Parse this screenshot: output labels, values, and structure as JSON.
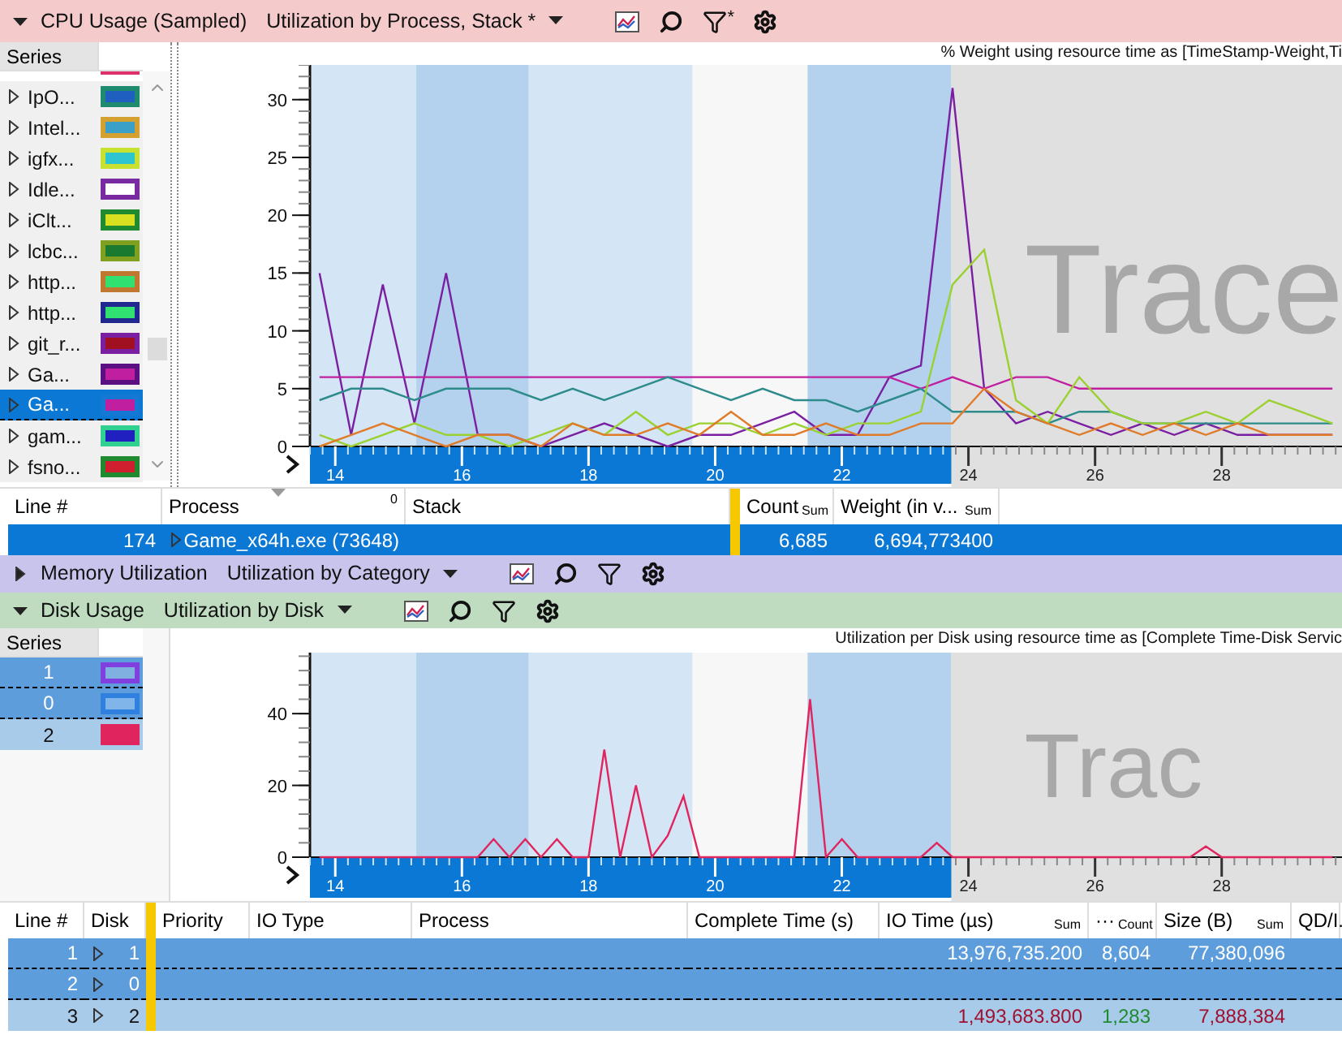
{
  "cpu_panel": {
    "header": {
      "expanded": true,
      "color": "#f4caca",
      "title": "CPU Usage (Sampled)",
      "preset": "Utilization by Process, Stack *",
      "filter_mark": "*"
    },
    "series_list": {
      "heading": "Series",
      "cut_off_swatch": {
        "color": "#e0306a"
      },
      "items": [
        {
          "name": "IpO...",
          "expanded": false,
          "swatch": {
            "fill": {
              "color": "#1f5fbf"
            },
            "border": {
              "color": "#1e8a6e"
            }
          },
          "selected": false
        },
        {
          "name": "Intel...",
          "expanded": false,
          "swatch": {
            "fill": {
              "color": "#3aa0c8"
            },
            "border": {
              "color": "#d4a030"
            }
          },
          "selected": false
        },
        {
          "name": "igfx...",
          "expanded": false,
          "swatch": {
            "fill": {
              "color": "#2ec4d0"
            },
            "border": {
              "color": "#c8e030"
            }
          },
          "selected": false
        },
        {
          "name": "Idle...",
          "expanded": false,
          "swatch": {
            "fill": {
              "color": "#ffffff"
            },
            "border": {
              "color": "#7a2aa0"
            }
          },
          "selected": false
        },
        {
          "name": "iClt...",
          "expanded": false,
          "swatch": {
            "fill": {
              "color": "#d8e020"
            },
            "border": {
              "color": "#208a30"
            }
          },
          "selected": false
        },
        {
          "name": "lcbc...",
          "expanded": false,
          "swatch": {
            "fill": {
              "color": "#1a7a30"
            },
            "border": {
              "color": "#80a020"
            }
          },
          "selected": false
        },
        {
          "name": "http...",
          "expanded": false,
          "swatch": {
            "fill": {
              "color": "#30e070"
            },
            "border": {
              "color": "#c07830"
            }
          },
          "selected": false
        },
        {
          "name": "http...",
          "expanded": false,
          "swatch": {
            "fill": {
              "color": "#30e070"
            },
            "border": {
              "color": "#202890"
            }
          },
          "selected": false
        },
        {
          "name": "git_r...",
          "expanded": false,
          "swatch": {
            "fill": {
              "color": "#a01020"
            },
            "border": {
              "color": "#7a1fa2"
            }
          },
          "selected": false
        },
        {
          "name": "Ga...",
          "expanded": false,
          "swatch": {
            "fill": {
              "color": "#c020a0"
            },
            "border": {
              "color": "#5a1080"
            }
          },
          "selected": false
        },
        {
          "name": "Ga...",
          "expanded": false,
          "swatch": {
            "fill": {
              "color": "#c020a0"
            },
            "border": {
              "color": "#1478d4"
            }
          },
          "selected": true
        },
        {
          "name": "gam...",
          "expanded": false,
          "swatch": {
            "fill": {
              "color": "#2020c0"
            },
            "border": {
              "color": "#30d090"
            }
          },
          "selected": false
        },
        {
          "name": "fsno...",
          "expanded": false,
          "swatch": {
            "fill": {
              "color": "#d02030"
            },
            "border": {
              "color": "#208a30"
            }
          },
          "selected": false
        }
      ]
    },
    "graph": {
      "title": "% Weight using resource time as [TimeStamp-Weight,Ti",
      "watermark": "Trace",
      "chart_data": {
        "type": "line",
        "x": [
          13.75,
          14.25,
          14.75,
          15.25,
          15.75,
          16.25,
          16.75,
          17.25,
          17.75,
          18.25,
          18.75,
          19.25,
          19.75,
          20.25,
          20.75,
          21.25,
          21.75,
          22.25,
          22.75,
          23.25,
          23.75,
          24.25,
          24.75,
          25.25,
          25.75,
          26.25,
          26.75,
          27.25,
          27.75,
          28.25,
          28.75,
          29.25,
          29.75
        ],
        "series": [
          {
            "color": "#7a1fa2",
            "values": [
              15,
              1,
              14,
              2,
              15,
              1,
              1,
              0,
              1,
              2,
              1,
              0,
              1,
              1,
              2,
              3,
              1,
              1,
              6,
              7,
              31,
              5,
              2,
              3,
              2,
              1,
              2,
              1,
              2,
              1,
              1,
              1,
              1
            ]
          },
          {
            "color": "#c020a0",
            "values": [
              6,
              6,
              6,
              6,
              6,
              6,
              6,
              6,
              6,
              6,
              6,
              6,
              6,
              6,
              6,
              6,
              6,
              6,
              6,
              5,
              6,
              5,
              6,
              6,
              5,
              5,
              5,
              5,
              5,
              5,
              5,
              5,
              5
            ]
          },
          {
            "color": "#2e8b8b",
            "values": [
              4,
              5,
              5,
              4,
              5,
              5,
              5,
              4,
              5,
              4,
              5,
              6,
              5,
              4,
              5,
              4,
              4,
              3,
              4,
              5,
              3,
              3,
              3,
              2,
              3,
              3,
              2,
              2,
              2,
              2,
              2,
              2,
              2
            ]
          },
          {
            "color": "#9ad130",
            "values": [
              1,
              0,
              1,
              2,
              1,
              1,
              0,
              1,
              2,
              1,
              3,
              1,
              2,
              2,
              1,
              2,
              1,
              2,
              2,
              3,
              14,
              17,
              4,
              2,
              6,
              3,
              2,
              2,
              3,
              2,
              4,
              3,
              2
            ]
          },
          {
            "color": "#e07b2a",
            "values": [
              0,
              1,
              2,
              1,
              0,
              1,
              1,
              0,
              2,
              1,
              1,
              2,
              1,
              3,
              1,
              1,
              2,
              1,
              1,
              2,
              2,
              5,
              3,
              2,
              1,
              2,
              1,
              2,
              1,
              2,
              1,
              1,
              1
            ]
          }
        ],
        "xlim": [
          13.6,
          29.9
        ],
        "ylim": [
          0,
          33
        ],
        "xticks": [
          14,
          16,
          18,
          20,
          22,
          24,
          26,
          28
        ],
        "yticks": [
          0,
          5,
          10,
          15,
          20,
          25,
          30
        ]
      }
    },
    "table": {
      "columns": [
        {
          "kind": "text",
          "label": "Line #"
        },
        {
          "kind": "text",
          "label": "Process",
          "sort_mark": "0"
        },
        {
          "kind": "text",
          "label": "Stack"
        },
        {
          "kind": "divider"
        },
        {
          "kind": "text",
          "label": "Count",
          "aggregate": "Sum"
        },
        {
          "kind": "text",
          "label": "Weight (in v...",
          "aggregate": "Sum"
        }
      ],
      "rows": [
        {
          "selected": true,
          "cells": [
            {
              "text": "174"
            },
            {
              "expanded": false,
              "text": "Game_x64h.exe (73648)"
            },
            null,
            null,
            {
              "text": "6,685"
            },
            {
              "text": "6,694,773400"
            }
          ]
        }
      ]
    }
  },
  "memory_panel": {
    "header": {
      "expanded": false,
      "color": "#c8c4ec",
      "title": "Memory Utilization",
      "preset": "Utilization by Category"
    }
  },
  "disk_panel": {
    "header": {
      "expanded": true,
      "color": "#bfdcc0",
      "title": "Disk Usage",
      "preset": "Utilization by Disk"
    },
    "series_list": {
      "heading": "Series",
      "items": [
        {
          "name": "1",
          "swatch": {
            "fill": {
              "color": "#7fb0e0"
            },
            "border": {
              "color": "#8040e0"
            }
          },
          "selected": true
        },
        {
          "name": "0",
          "swatch": {
            "fill": {
              "color": "#7fb5e8"
            },
            "border": {
              "color": "#3080e0"
            }
          },
          "selected": true
        },
        {
          "name": "2",
          "swatch": {
            "fill": {
              "color": "#e0245e"
            }
          },
          "selected": false
        }
      ]
    },
    "graph": {
      "title": "Utilization per Disk using resource time as [Complete Time-Disk Servic",
      "watermark": "Trac",
      "chart_data": {
        "type": "line",
        "x": [
          13.75,
          14,
          14.25,
          14.5,
          14.75,
          15,
          15.25,
          15.5,
          15.75,
          16,
          16.25,
          16.5,
          16.75,
          17,
          17.25,
          17.5,
          17.75,
          18,
          18.25,
          18.5,
          18.75,
          19,
          19.25,
          19.5,
          19.75,
          20,
          20.25,
          20.5,
          20.75,
          21,
          21.25,
          21.5,
          21.75,
          22,
          22.25,
          22.5,
          22.75,
          23,
          23.25,
          23.5,
          23.75,
          24,
          24.25,
          24.5,
          24.75,
          25,
          25.25,
          25.5,
          25.75,
          26,
          26.25,
          26.5,
          26.75,
          27,
          27.25,
          27.5,
          27.75,
          28,
          28.25,
          28.5,
          28.75,
          29,
          29.25,
          29.5,
          29.75
        ],
        "series": [
          {
            "color": "#e0245e",
            "values": [
              0,
              0,
              0,
              0,
              0,
              0,
              0,
              0,
              0,
              0,
              0,
              5,
              0,
              5,
              0,
              5,
              0,
              0,
              30,
              0,
              20,
              0,
              6,
              17,
              0,
              0,
              0,
              0,
              0,
              0,
              0,
              44,
              0,
              5,
              0,
              0,
              0,
              0,
              0,
              4,
              0,
              0,
              0,
              0,
              0,
              0,
              0,
              0,
              0,
              0,
              0,
              0,
              0,
              0,
              0,
              0,
              3,
              0,
              0,
              0,
              0,
              0,
              0,
              0,
              0
            ]
          }
        ],
        "xlim": [
          13.6,
          29.9
        ],
        "ylim": [
          0,
          57
        ],
        "xticks": [
          14,
          16,
          18,
          20,
          22,
          24,
          26,
          28
        ],
        "yticks": [
          0,
          20,
          40
        ]
      }
    },
    "table": {
      "columns": [
        {
          "kind": "text",
          "label": "Line #"
        },
        {
          "kind": "text",
          "label": "Disk"
        },
        {
          "kind": "divider"
        },
        {
          "kind": "text",
          "label": "Priority"
        },
        {
          "kind": "text",
          "label": "IO Type"
        },
        {
          "kind": "text",
          "label": "Process"
        },
        {
          "kind": "text",
          "label": "Complete Time (s)"
        },
        {
          "kind": "text",
          "label": "IO Time (µs)",
          "aggregate": "Sum"
        },
        {
          "kind": "text",
          "label": "···",
          "aggregate": "Count"
        },
        {
          "kind": "text",
          "label": "Size (B)",
          "aggregate": "Sum"
        },
        {
          "kind": "text",
          "label": "QD/I."
        }
      ],
      "rows": [
        {
          "selected": true,
          "cells": [
            {
              "text": "1"
            },
            {
              "expanded": false,
              "text": "1"
            },
            null,
            null,
            null,
            null,
            null,
            {
              "text": "13,976,735.200"
            },
            {
              "text": "8,604"
            },
            {
              "text": "77,380,096"
            },
            null
          ]
        },
        {
          "selected": true,
          "cells": [
            {
              "text": "2"
            },
            {
              "expanded": false,
              "text": "0"
            },
            null,
            null,
            null,
            null,
            null,
            null,
            null,
            null,
            null
          ]
        },
        {
          "selected": false,
          "cells": [
            {
              "text": "3"
            },
            {
              "expanded": false,
              "text": "2"
            },
            null,
            null,
            null,
            null,
            null,
            {
              "text": "1,493,683.800",
              "color": "#a01030"
            },
            {
              "text": "1,283",
              "color": "#208a30"
            },
            {
              "text": "7,888,384",
              "color": "#a01030"
            },
            null
          ]
        }
      ]
    }
  }
}
